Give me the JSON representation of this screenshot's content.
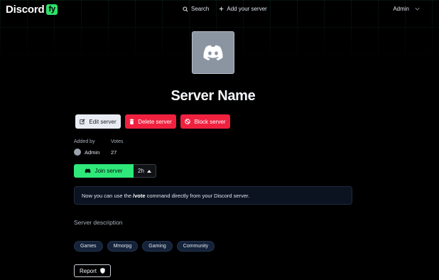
{
  "nav": {
    "logo_text": "Discord",
    "logo_badge": "fy",
    "search_label": "Search",
    "add_server_label": "Add your server",
    "user_label": "Admin"
  },
  "server": {
    "name": "Server Name",
    "icon": "discord-logo-icon"
  },
  "actions": {
    "edit_label": "Edit server",
    "delete_label": "Delete server",
    "block_label": "Block server"
  },
  "meta": {
    "added_by_label": "Added by",
    "added_by_value": "Admin",
    "votes_label": "Votes",
    "votes_value": "27"
  },
  "join": {
    "join_label": "Join server",
    "time_label": "2h"
  },
  "info": {
    "prefix": "Now you can use the",
    "command": "/vote",
    "suffix": "command directly from your Discord server."
  },
  "description": {
    "title": "Server description"
  },
  "tags": [
    "Games",
    "Mmorpg",
    "Gaming",
    "Community"
  ],
  "report": {
    "label": "Report"
  },
  "colors": {
    "accent_green": "#2ee87a",
    "danger_red": "#f0213f",
    "background": "#000000"
  }
}
